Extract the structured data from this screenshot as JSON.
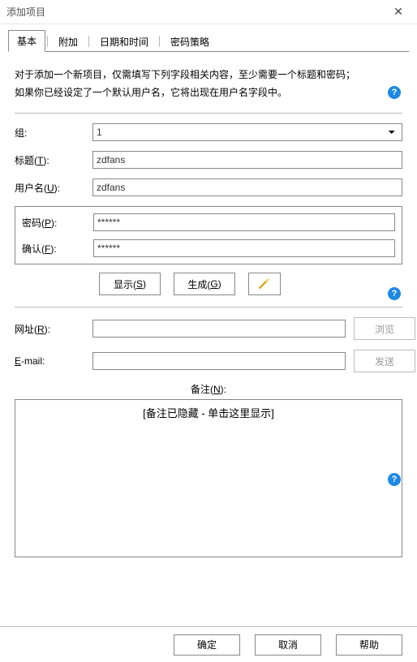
{
  "window": {
    "title": "添加项目"
  },
  "tabs": {
    "basic": "基本",
    "extra": "附加",
    "datetime": "日期和时间",
    "policy": "密码策略"
  },
  "intro": {
    "line1": "对于添加一个新项目，仅需填写下列字段相关内容，至少需要一个标题和密码；",
    "line2": "如果你已经设定了一个默认用户名，它将出现在用户名字段中。"
  },
  "labels": {
    "group": "组:",
    "title_pre": "标题(",
    "title_key": "T",
    "title_post": "):",
    "username_pre": "用户名(",
    "username_key": "U",
    "username_post": "):",
    "password_pre": "密码(",
    "password_key": "P",
    "password_post": "):",
    "confirm_pre": "确认(",
    "confirm_key": "F",
    "confirm_post": "):",
    "url_pre": "网址(",
    "url_key": "R",
    "url_post": "):",
    "email_pre": "",
    "email_key": "E",
    "email_post": "-mail:",
    "notes_pre": "备注(",
    "notes_key": "N",
    "notes_post": "):"
  },
  "values": {
    "group": "1",
    "title": "zdfans",
    "username": "zdfans",
    "password": "******",
    "confirm": "******",
    "url": "",
    "email": "",
    "notes_hidden": "[备注已隐藏 - 单击这里显示]"
  },
  "buttons": {
    "show_pre": "显示(",
    "show_key": "S",
    "show_post": ")",
    "gen_pre": "生成(",
    "gen_key": "G",
    "gen_post": ")",
    "browse": "浏览",
    "send": "发送",
    "ok": "确定",
    "cancel": "取消",
    "help": "帮助"
  }
}
